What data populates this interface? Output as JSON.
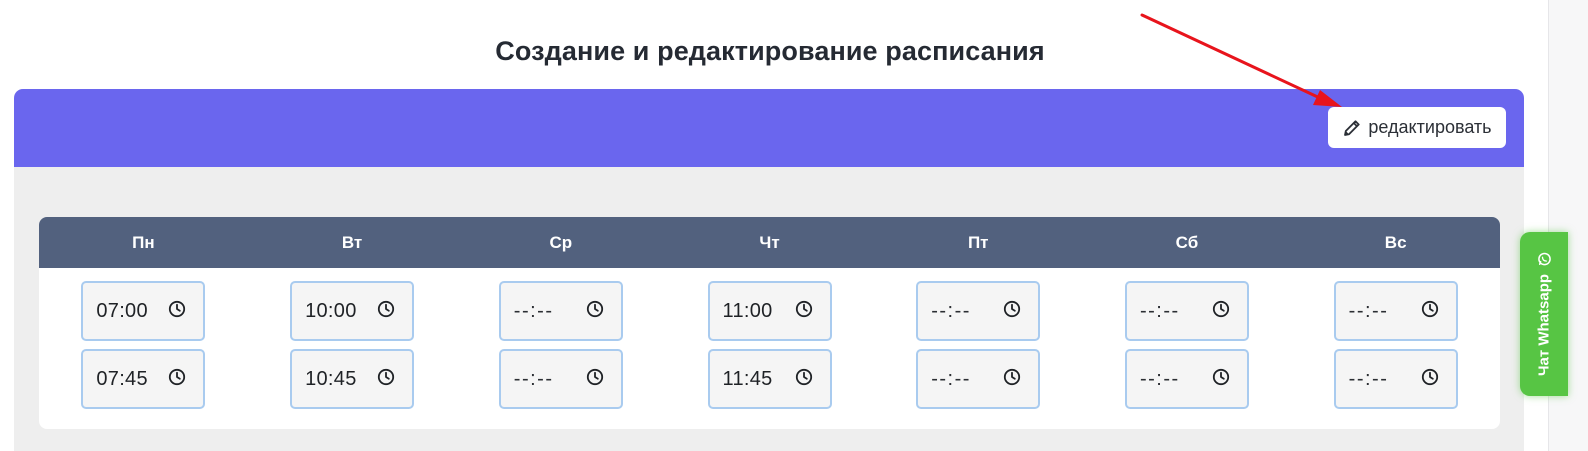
{
  "page": {
    "title": "Создание и редактирование расписания"
  },
  "header": {
    "edit_label": "редактировать",
    "edit_icon": "pencil-icon",
    "color": "#6a66ee"
  },
  "schedule": {
    "days": [
      {
        "label": "Пн",
        "slots": [
          "07:00",
          "07:45"
        ]
      },
      {
        "label": "Вт",
        "slots": [
          "10:00",
          "10:45"
        ]
      },
      {
        "label": "Ср",
        "slots": [
          "--:--",
          "--:--"
        ]
      },
      {
        "label": "Чт",
        "slots": [
          "11:00",
          "11:45"
        ]
      },
      {
        "label": "Пт",
        "slots": [
          "--:--",
          "--:--"
        ]
      },
      {
        "label": "Сб",
        "slots": [
          "--:--",
          "--:--"
        ]
      },
      {
        "label": "Вс",
        "slots": [
          "--:--",
          "--:--"
        ]
      }
    ],
    "slot_icon": "clock-icon",
    "header_color": "#52617e"
  },
  "whatsapp": {
    "label": "Чат Whatsapp",
    "icon": "whatsapp-icon",
    "color": "#57c544"
  },
  "annotation": {
    "arrow_color": "#e8141c"
  }
}
